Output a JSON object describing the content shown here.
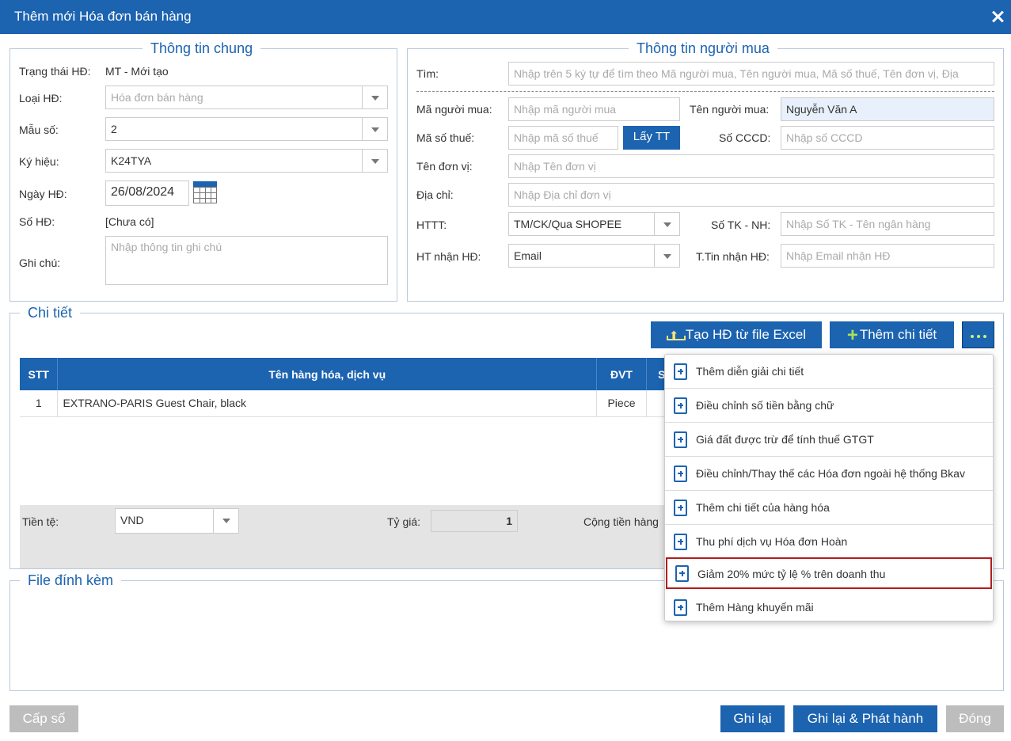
{
  "window": {
    "title": "Thêm mới Hóa đơn bán hàng"
  },
  "general": {
    "legend": "Thông tin chung",
    "status_label": "Trạng thái HĐ:",
    "status_value": "MT - Mới tạo",
    "type_label": "Loại HĐ:",
    "type_value": "Hóa đơn bán hàng",
    "form_label": "Mẫu số:",
    "form_value": "2",
    "symbol_label": "Ký hiệu:",
    "symbol_value": "K24TYA",
    "date_label": "Ngày HĐ:",
    "date_value": "26/08/2024",
    "number_label": "Số HĐ:",
    "number_value": "[Chưa có]",
    "note_label": "Ghi chú:",
    "note_placeholder": "Nhập thông tin ghi chú"
  },
  "buyer": {
    "legend": "Thông tin người mua",
    "search_label": "Tìm:",
    "search_placeholder": "Nhập trên 5 ký tự để tìm theo Mã người mua, Tên người mua, Mã số thuế, Tên đơn vị, Địa",
    "code_label": "Mã người mua:",
    "code_placeholder": "Nhập mã người mua",
    "name_label": "Tên người mua:",
    "name_value": "Nguyễn Văn A",
    "tax_label": "Mã số thuế:",
    "tax_placeholder": "Nhập mã số thuế",
    "fetch_button": "Lấy TT",
    "id_label": "Số CCCD:",
    "id_placeholder": "Nhập số CCCD",
    "unit_label": "Tên đơn vị:",
    "unit_placeholder": "Nhập Tên đơn vị",
    "address_label": "Địa chỉ:",
    "address_placeholder": "Nhập Địa chỉ đơn vị",
    "payment_label": "HTTT:",
    "payment_value": "TM/CK/Qua SHOPEE",
    "bank_label": "Số TK - NH:",
    "bank_placeholder": "Nhập Số TK - Tên ngân hàng",
    "receive_label": "HT nhận HĐ:",
    "receive_value": "Email",
    "receive_info_label": "T.Tin nhận HĐ:",
    "receive_info_placeholder": "Nhập Email nhận HĐ"
  },
  "detail": {
    "legend": "Chi tiết",
    "excel_button": "Tạo HĐ từ file Excel",
    "add_button": "Thêm chi tiết",
    "columns": {
      "stt": "STT",
      "name": "Tên hàng hóa, dịch vụ",
      "unit": "ĐVT",
      "qty": "S"
    },
    "rows": [
      {
        "stt": "1",
        "name": "EXTRANO-PARIS Guest Chair, black",
        "unit": "Piece"
      }
    ],
    "currency_label": "Tiền tệ:",
    "currency_value": "VND",
    "rate_label": "Tỷ giá:",
    "rate_value": "1",
    "total_label": "Cộng tiền hàng"
  },
  "attach": {
    "legend": "File đính kèm"
  },
  "menu": {
    "items": [
      "Thêm diễn giải chi tiết",
      "Điều chỉnh số tiền bằng chữ",
      "Giá đất được trừ để tính thuế GTGT",
      "Điều chỉnh/Thay thế các Hóa đơn ngoài hệ thống Bkav",
      "Thêm chi tiết của hàng hóa",
      "Thu phí dịch vụ Hóa đơn Hoàn",
      "Giảm 20% mức tỷ lệ % trên doanh thu",
      "Thêm Hàng khuyến mãi"
    ],
    "highlighted_index": 6
  },
  "footer": {
    "issue_number": "Cấp số",
    "save": "Ghi lại",
    "save_publish": "Ghi lại & Phát hành",
    "close": "Đóng"
  },
  "colors": {
    "primary": "#1c63b0",
    "highlight_border": "#b01e1e",
    "disabled": "#bdbdbd"
  }
}
